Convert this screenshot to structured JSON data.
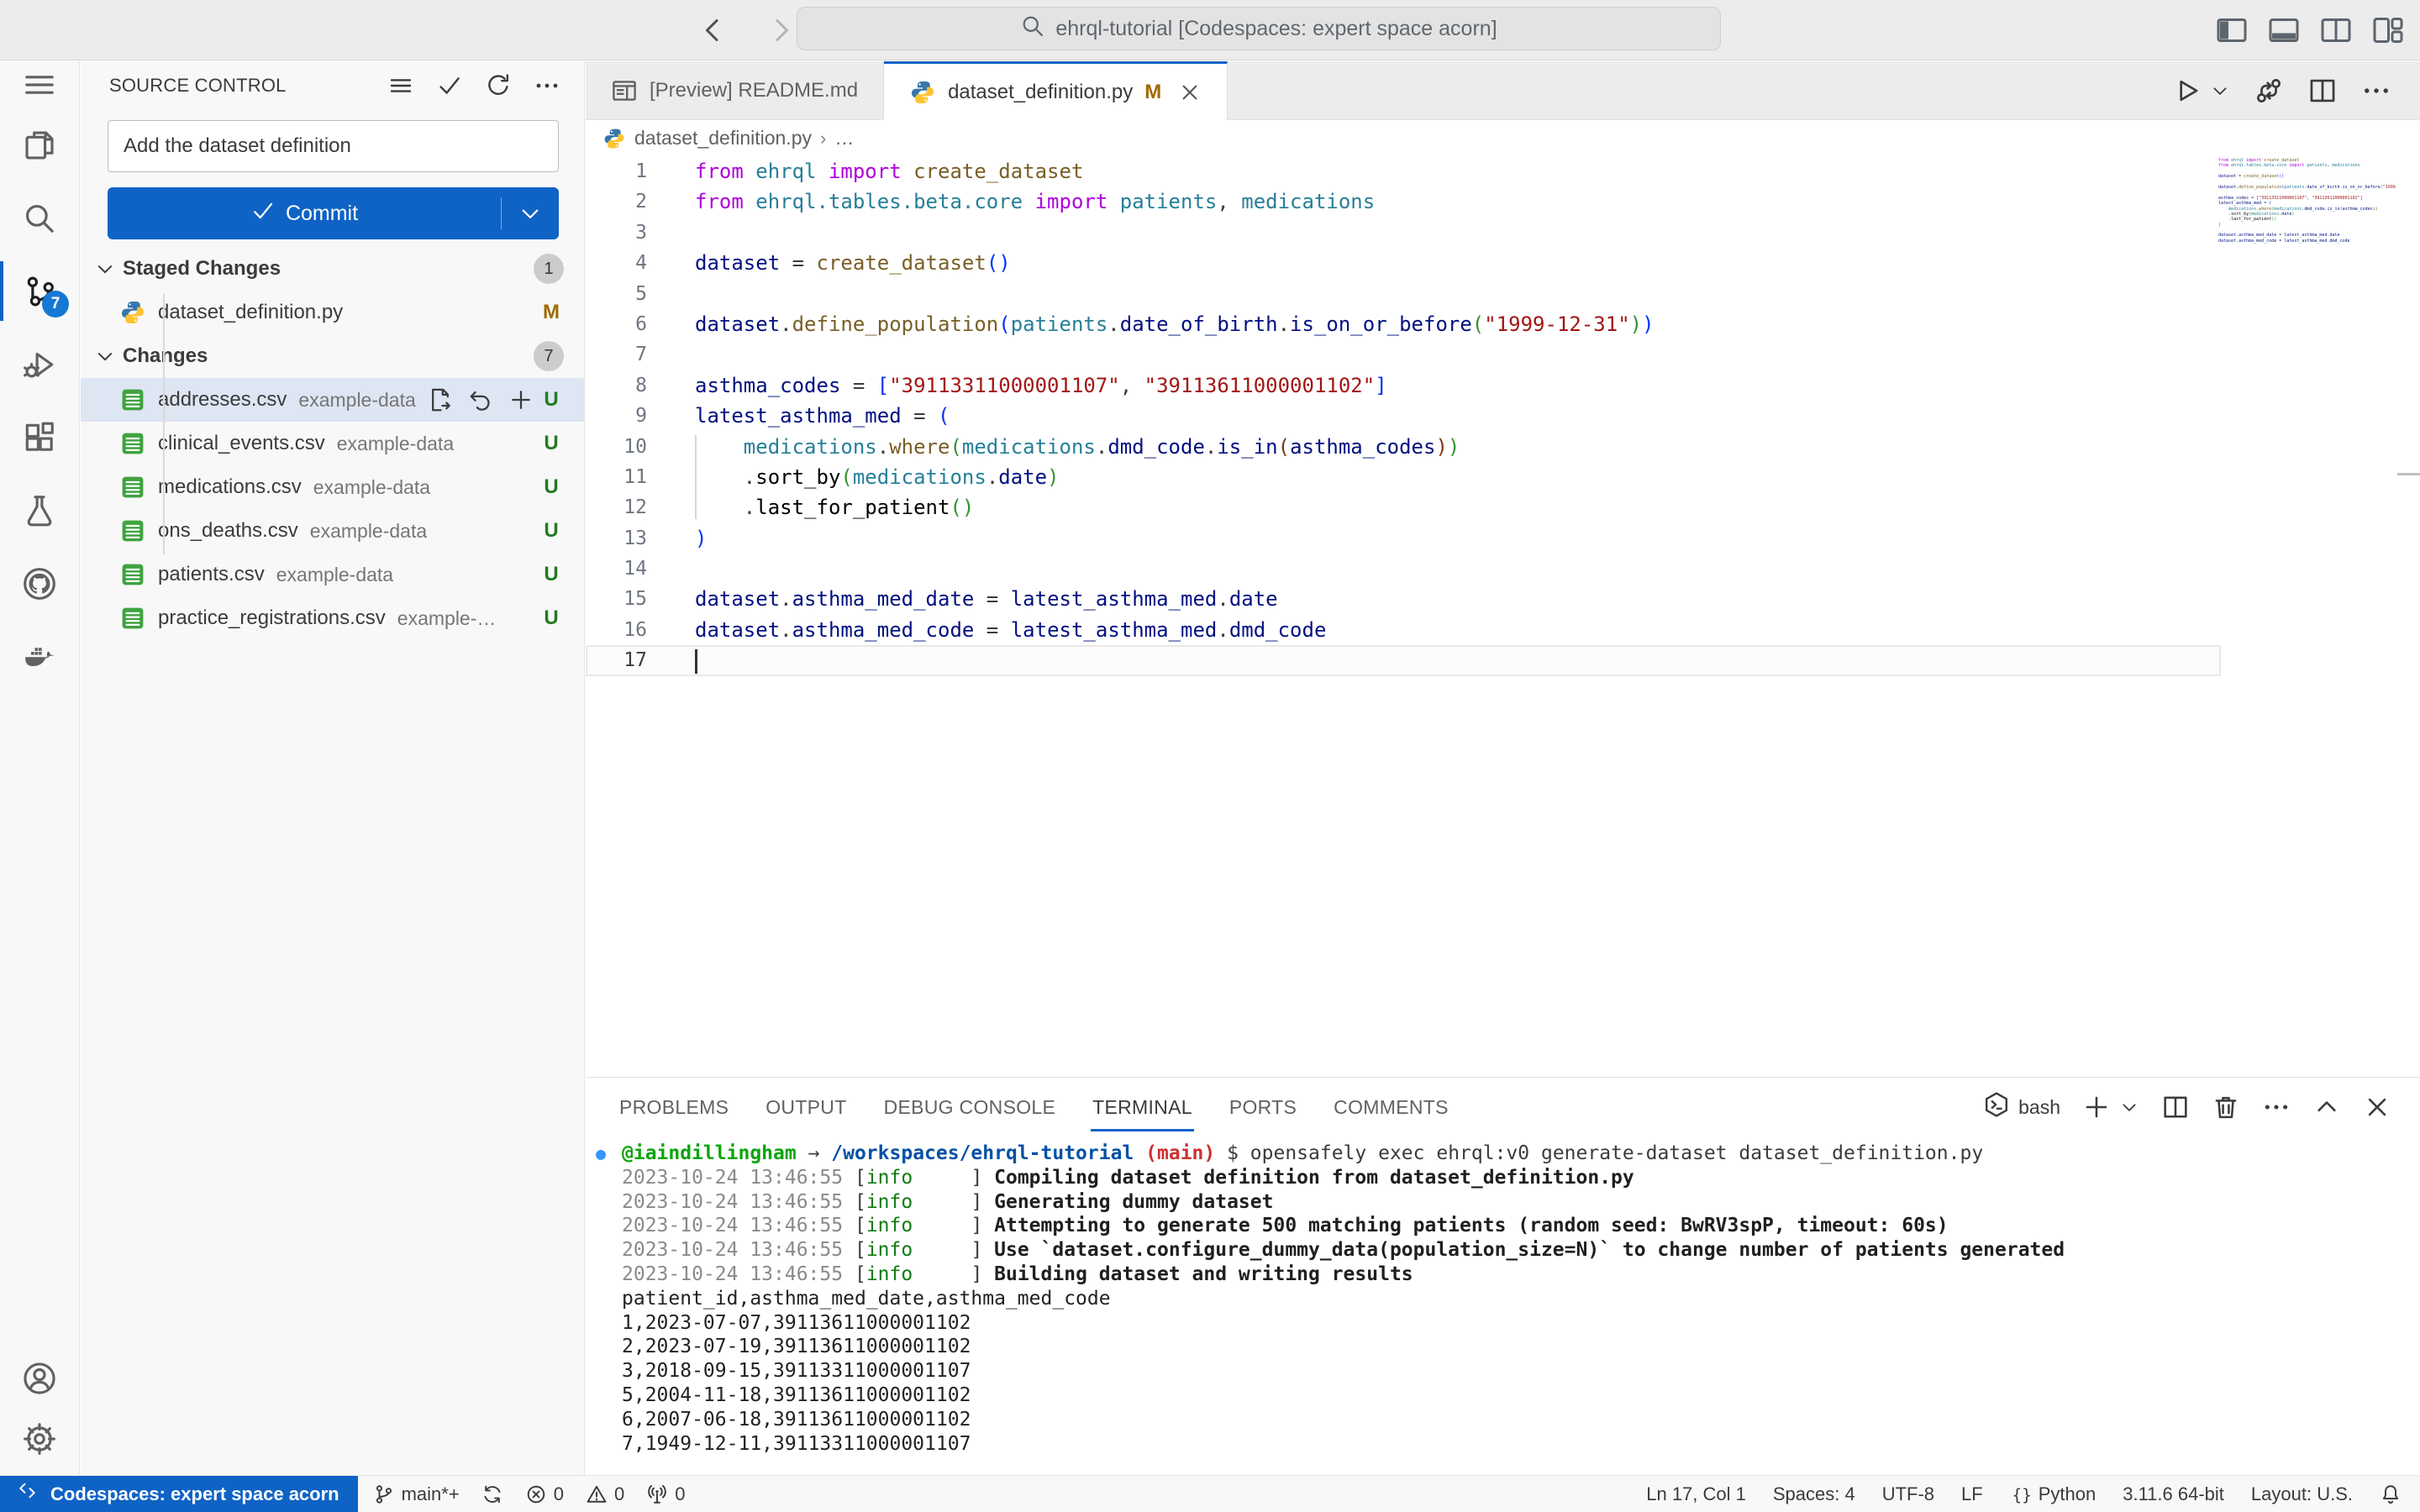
{
  "colors": {
    "accent": "#0f63c5",
    "badge_blue": "#1678d4",
    "modified": "#9e6a03",
    "untracked": "#227a22"
  },
  "titlebar": {
    "search_text": "ehrql-tutorial [Codespaces: expert space acorn]",
    "window_controls": [
      "layout-sidebar",
      "layout-panel",
      "layout-split",
      "layout-custom"
    ]
  },
  "activity_bar": {
    "top": [
      {
        "id": "menu"
      },
      {
        "id": "explorer"
      },
      {
        "id": "search"
      },
      {
        "id": "source-control",
        "active": true,
        "badge": "7"
      },
      {
        "id": "debug"
      },
      {
        "id": "extensions"
      },
      {
        "id": "testing"
      },
      {
        "id": "github"
      },
      {
        "id": "docker"
      }
    ],
    "bottom": [
      {
        "id": "account"
      },
      {
        "id": "settings"
      }
    ]
  },
  "sidebar": {
    "title": "SOURCE CONTROL",
    "header_icons": [
      "view-list",
      "check",
      "refresh",
      "ellipsis"
    ],
    "message": "Add the dataset definition",
    "commit_label": "Commit",
    "sections": [
      {
        "label": "Staged Changes",
        "count": "1",
        "files": [
          {
            "icon": "python",
            "name": "dataset_definition.py",
            "status": "M"
          }
        ]
      },
      {
        "label": "Changes",
        "count": "7",
        "files": [
          {
            "icon": "csv",
            "name": "addresses.csv",
            "desc": "example-data",
            "status": "U",
            "selected": true,
            "actions": [
              "open-file",
              "discard",
              "plus"
            ]
          },
          {
            "icon": "csv",
            "name": "clinical_events.csv",
            "desc": "example-data",
            "status": "U"
          },
          {
            "icon": "csv",
            "name": "medications.csv",
            "desc": "example-data",
            "status": "U"
          },
          {
            "icon": "csv",
            "name": "ons_deaths.csv",
            "desc": "example-data",
            "status": "U"
          },
          {
            "icon": "csv",
            "name": "patients.csv",
            "desc": "example-data",
            "status": "U"
          },
          {
            "icon": "csv",
            "name": "practice_registrations.csv",
            "desc": "example-…",
            "status": "U"
          }
        ]
      }
    ]
  },
  "editor": {
    "tabs": [
      {
        "icon": "preview",
        "label": "[Preview] README.md",
        "active": false
      },
      {
        "icon": "python",
        "label": "dataset_definition.py",
        "badge": "M",
        "active": true,
        "closable": true
      }
    ],
    "actions": [
      "play",
      "chev-down-small",
      "compare",
      "split",
      "ellipsis"
    ],
    "breadcrumb": {
      "icon": "python",
      "path": "dataset_definition.py",
      "more": "…"
    },
    "cursor_line": 17,
    "code_lines": [
      {
        "n": 1,
        "t": [
          [
            "k",
            "from"
          ],
          [
            "p",
            " "
          ],
          [
            "m",
            "ehrql"
          ],
          [
            "p",
            " "
          ],
          [
            "k",
            "import"
          ],
          [
            "p",
            " "
          ],
          [
            "f",
            "create_dataset"
          ]
        ]
      },
      {
        "n": 2,
        "t": [
          [
            "k",
            "from"
          ],
          [
            "p",
            " "
          ],
          [
            "m",
            "ehrql.tables.beta.core"
          ],
          [
            "p",
            " "
          ],
          [
            "k",
            "import"
          ],
          [
            "p",
            " "
          ],
          [
            "m",
            "patients"
          ],
          [
            "p",
            ", "
          ],
          [
            "m",
            "medications"
          ]
        ]
      },
      {
        "n": 3,
        "t": []
      },
      {
        "n": 4,
        "t": [
          [
            "v",
            "dataset"
          ],
          [
            "p",
            " = "
          ],
          [
            "f",
            "create_dataset"
          ],
          [
            "b1",
            "()"
          ]
        ]
      },
      {
        "n": 5,
        "t": []
      },
      {
        "n": 6,
        "t": [
          [
            "v",
            "dataset"
          ],
          [
            "p",
            "."
          ],
          [
            "f",
            "define_population"
          ],
          [
            "b1",
            "("
          ],
          [
            "m",
            "patients"
          ],
          [
            "p",
            "."
          ],
          [
            "v",
            "date_of_birth"
          ],
          [
            "p",
            "."
          ],
          [
            "v",
            "is_on_or_before"
          ],
          [
            "b2",
            "("
          ],
          [
            "s",
            "\"1999-12-31\""
          ],
          [
            "b2",
            ")"
          ],
          [
            "b1",
            ")"
          ]
        ]
      },
      {
        "n": 7,
        "t": []
      },
      {
        "n": 8,
        "t": [
          [
            "v",
            "asthma_codes"
          ],
          [
            "p",
            " = "
          ],
          [
            "b1",
            "["
          ],
          [
            "s",
            "\"39113311000001107\""
          ],
          [
            "p",
            ", "
          ],
          [
            "s",
            "\"39113611000001102\""
          ],
          [
            "b1",
            "]"
          ]
        ]
      },
      {
        "n": 9,
        "t": [
          [
            "v",
            "latest_asthma_med"
          ],
          [
            "p",
            " = "
          ],
          [
            "b1",
            "("
          ]
        ]
      },
      {
        "n": 10,
        "t": [
          [
            "p",
            "    "
          ],
          [
            "m",
            "medications"
          ],
          [
            "p",
            "."
          ],
          [
            "f",
            "where"
          ],
          [
            "b2",
            "("
          ],
          [
            "m",
            "medications"
          ],
          [
            "p",
            "."
          ],
          [
            "v",
            "dmd_code"
          ],
          [
            "p",
            "."
          ],
          [
            "v",
            "is_in"
          ],
          [
            "b3",
            "("
          ],
          [
            "v",
            "asthma_codes"
          ],
          [
            "b3",
            ")"
          ],
          [
            "b2",
            ")"
          ]
        ]
      },
      {
        "n": 11,
        "t": [
          [
            "p",
            "    ."
          ],
          [
            "t",
            "sort_by"
          ],
          [
            "b2",
            "("
          ],
          [
            "m",
            "medications"
          ],
          [
            "p",
            "."
          ],
          [
            "v",
            "date"
          ],
          [
            "b2",
            ")"
          ]
        ]
      },
      {
        "n": 12,
        "t": [
          [
            "p",
            "    ."
          ],
          [
            "t",
            "last_for_patient"
          ],
          [
            "b2",
            "()"
          ]
        ]
      },
      {
        "n": 13,
        "t": [
          [
            "b1",
            ")"
          ]
        ]
      },
      {
        "n": 14,
        "t": []
      },
      {
        "n": 15,
        "t": [
          [
            "v",
            "dataset"
          ],
          [
            "p",
            "."
          ],
          [
            "v",
            "asthma_med_date"
          ],
          [
            "p",
            " = "
          ],
          [
            "v",
            "latest_asthma_med"
          ],
          [
            "p",
            "."
          ],
          [
            "v",
            "date"
          ]
        ]
      },
      {
        "n": 16,
        "t": [
          [
            "v",
            "dataset"
          ],
          [
            "p",
            "."
          ],
          [
            "v",
            "asthma_med_code"
          ],
          [
            "p",
            " = "
          ],
          [
            "v",
            "latest_asthma_med"
          ],
          [
            "p",
            "."
          ],
          [
            "v",
            "dmd_code"
          ]
        ]
      },
      {
        "n": 17,
        "t": []
      }
    ]
  },
  "panel": {
    "tabs": [
      {
        "label": "PROBLEMS"
      },
      {
        "label": "OUTPUT"
      },
      {
        "label": "DEBUG CONSOLE"
      },
      {
        "label": "TERMINAL",
        "active": true
      },
      {
        "label": "PORTS"
      },
      {
        "label": "COMMENTS"
      }
    ],
    "terminal_chip": "bash",
    "chip_icon": "terminal-bash",
    "actions": [
      "plus",
      "chev-down-small",
      "split",
      "trash",
      "ellipsis",
      "chev-up",
      "close"
    ],
    "terminal_lines": [
      [
        [
          "dot",
          "●"
        ],
        [
          "u",
          "@iaindillingham"
        ],
        [
          "p",
          " → "
        ],
        [
          "path",
          "/workspaces/ehrql-tutorial"
        ],
        [
          "p",
          " "
        ],
        [
          "br",
          "(main)"
        ],
        [
          "p",
          " $ opensafely exec ehrql:v0 generate-dataset dataset_definition.py"
        ]
      ],
      [
        [
          "ts",
          "2023-10-24 13:46:55 "
        ],
        [
          "p",
          "["
        ],
        [
          "info",
          "info"
        ],
        [
          "p",
          "     ] "
        ],
        [
          "msg",
          "Compiling dataset definition from dataset_definition.py"
        ]
      ],
      [
        [
          "ts",
          "2023-10-24 13:46:55 "
        ],
        [
          "p",
          "["
        ],
        [
          "info",
          "info"
        ],
        [
          "p",
          "     ] "
        ],
        [
          "msg",
          "Generating dummy dataset"
        ]
      ],
      [
        [
          "ts",
          "2023-10-24 13:46:55 "
        ],
        [
          "p",
          "["
        ],
        [
          "info",
          "info"
        ],
        [
          "p",
          "     ] "
        ],
        [
          "msg",
          "Attempting to generate 500 matching patients (random seed: BwRV3spP, timeout: 60s)"
        ]
      ],
      [
        [
          "ts",
          "2023-10-24 13:46:55 "
        ],
        [
          "p",
          "["
        ],
        [
          "info",
          "info"
        ],
        [
          "p",
          "     ] "
        ],
        [
          "msg",
          "Use `dataset.configure_dummy_data(population_size=N)` to change number of patients generated"
        ]
      ],
      [
        [
          "ts",
          "2023-10-24 13:46:55 "
        ],
        [
          "p",
          "["
        ],
        [
          "info",
          "info"
        ],
        [
          "p",
          "     ] "
        ],
        [
          "msg",
          "Building dataset and writing results"
        ]
      ],
      [
        [
          "csv",
          "patient_id,asthma_med_date,asthma_med_code"
        ]
      ],
      [
        [
          "csv",
          "1,2023-07-07,39113611000001102"
        ]
      ],
      [
        [
          "csv",
          "2,2023-07-19,39113611000001102"
        ]
      ],
      [
        [
          "csv",
          "3,2018-09-15,39113311000001107"
        ]
      ],
      [
        [
          "csv",
          "5,2004-11-18,39113611000001102"
        ]
      ],
      [
        [
          "csv",
          "6,2007-06-18,39113611000001102"
        ]
      ],
      [
        [
          "csv",
          "7,1949-12-11,39113311000001107"
        ]
      ]
    ]
  },
  "statusbar": {
    "remote": {
      "icon": "remote",
      "label": "Codespaces: expert space acorn"
    },
    "left": [
      {
        "icon": "branch",
        "label": "main*+",
        "name": "branch-indicator"
      },
      {
        "icon": "sync",
        "label": "",
        "name": "sync-button"
      },
      {
        "icon": "error",
        "label": "0",
        "name": "error-count"
      },
      {
        "icon": "warning",
        "label": "0",
        "name": "warning-count"
      },
      {
        "icon": "radio",
        "label": "0",
        "name": "ports-indicator"
      }
    ],
    "right": [
      {
        "label": "Ln 17, Col 1",
        "name": "cursor-position"
      },
      {
        "label": "Spaces: 4",
        "name": "indentation"
      },
      {
        "label": "UTF-8",
        "name": "encoding"
      },
      {
        "label": "LF",
        "name": "eol-sequence"
      },
      {
        "icon": "braces",
        "label": "Python",
        "name": "language-mode"
      },
      {
        "label": "3.11.6 64-bit",
        "name": "python-interpreter"
      },
      {
        "label": "Layout: U.S.",
        "name": "keyboard-layout"
      },
      {
        "icon": "bell",
        "label": "",
        "name": "notifications-bell"
      }
    ]
  }
}
